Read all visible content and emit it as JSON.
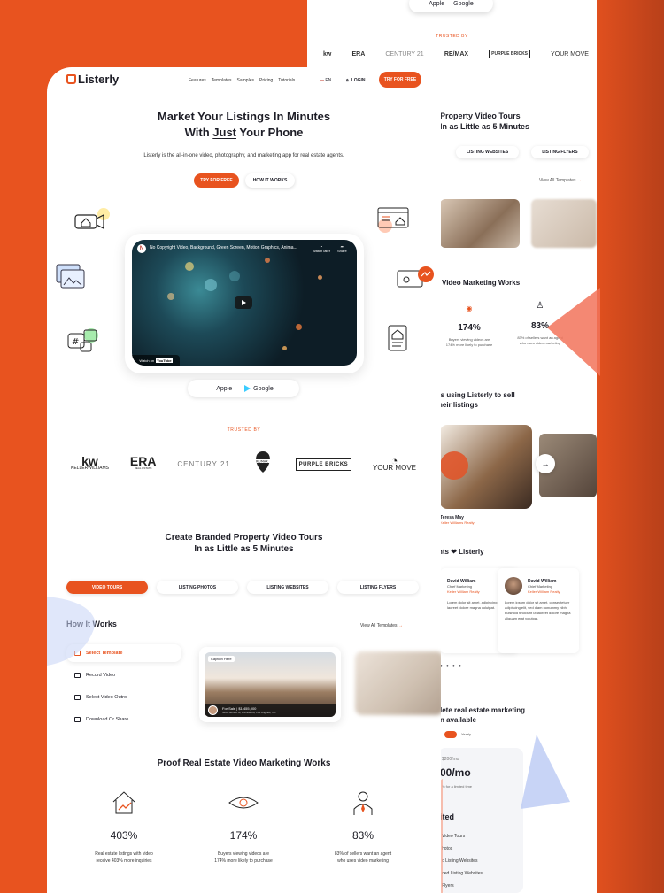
{
  "back": {
    "store": {
      "apple": "Apple",
      "google": "Google"
    },
    "trusted": "TRUSTED BY",
    "logos": [
      "kw",
      "ERA",
      "CENTURY 21",
      "RE/MAX",
      "PURPLE BRICKS",
      "YOUR MOVE"
    ],
    "heading": "Property Video Tours\nIn as Little as 5 Minutes",
    "tabs": [
      "LISTING WEBSITES",
      "LISTING FLYERS"
    ],
    "view_all": "View All Templates",
    "proof": "Video Marketing Works",
    "stat1": {
      "value": "174%",
      "label": "Buyers viewing videos are\n174% more likely to purchase"
    },
    "stat2": {
      "value": "83%",
      "label": "83% of sellers want an agent\nwho uses video marketing"
    },
    "agents": "ts using Listerly to sell\nheir listings",
    "agent_name": "Teresa May",
    "agent_company": "Keller Williams Realty",
    "love": "nts ❤ Listerly",
    "testimonials": [
      {
        "name": "David William",
        "role": "Chief Marketing",
        "company": "Keller William Realty",
        "text": "Lorem dolor sit amet, adipiscing elit, sed laoreet dolore magna volutpat."
      },
      {
        "name": "David William",
        "role": "Chief Marketing",
        "company": "Keller William Realty",
        "text": "Lorem ipsum dolor sit amet, consectetuer adipiscing elit, sed diam nonummy nibh euismod tincidunt ut laoreet dolore magna aliquam erat volutpat."
      }
    ],
    "dots": "• • • •",
    "complete": "lete real estate marketing\nn available",
    "toggle_label": "Yearly",
    "price_old": "$200/mo",
    "price": "00/mo",
    "price_note": "% for a limited time",
    "plan_title": "ited",
    "plan_items": [
      "Video Tours",
      "hotos",
      "d Listing Websites",
      "ded Listing Websites",
      "Flyers"
    ]
  },
  "nav": {
    "brand": "Listerly",
    "links": [
      "Features",
      "Templates",
      "Samples",
      "Pricing",
      "Tutorials"
    ],
    "lang": "EN",
    "login": "LOGIN",
    "try": "TRY FOR FREE"
  },
  "hero": {
    "title_line1": "Market Your Listings In Minutes",
    "title_pre": "With ",
    "title_underline": "Just",
    "title_post": " Your Phone",
    "subtitle": "Listerly is the all-in-one video, photography, and marketing app for real estate agents.",
    "try_button": "TRY FOR FREE",
    "how_button": "HOW IT WORKS"
  },
  "video": {
    "channel_initial": "N",
    "title": "No Copyright Video, Background, Green Screen, Motion Graphics, Anima...",
    "watch_later": "Watch later",
    "share": "Share",
    "watch_on": "Watch on",
    "youtube": "YouTube"
  },
  "store": {
    "apple": "Apple",
    "google": "Google"
  },
  "trusted": {
    "label": "TRUSTED BY",
    "kw": "kw",
    "kw_sub": "KELLERWILLIAMS",
    "era": "ERA",
    "era_sub": "REAL ESTATE",
    "c21": "CENTURY 21",
    "remax": "RE/MAX",
    "purple": "PURPLE BRICKS",
    "yourmove": "YOUR MOVE"
  },
  "templates": {
    "title": "Create Branded Property Video Tours\nIn as Little as 5 Minutes",
    "tabs": [
      "VIDEO TOURS",
      "LISTING PHOTOS",
      "LISTING WEBSITES",
      "LISTING FLYERS"
    ],
    "how_title": "How It Works",
    "view_all": "View All Templates",
    "steps": [
      "Select Template",
      "Record Video",
      "Select Video Outro",
      "Download Or Share"
    ],
    "caption": "Caption Here",
    "forsale": "For Sale | $1,455,000",
    "address": "4420 Sunset St, Brentwood, Los Angeles, CA"
  },
  "proof": {
    "title": "Proof Real Estate Video Marketing Works",
    "stats": [
      {
        "value": "403%",
        "label": "Real estate listings with video\nreceive 403% more inquiries"
      },
      {
        "value": "174%",
        "label": "Buyers viewing videos are\n174% more likely to purchase"
      },
      {
        "value": "83%",
        "label": "83% of sellers want an agent\nwho uses video marketing"
      }
    ]
  },
  "colors": {
    "accent": "#e8531f",
    "background": "#e8531f",
    "text": "#1d1d26"
  }
}
